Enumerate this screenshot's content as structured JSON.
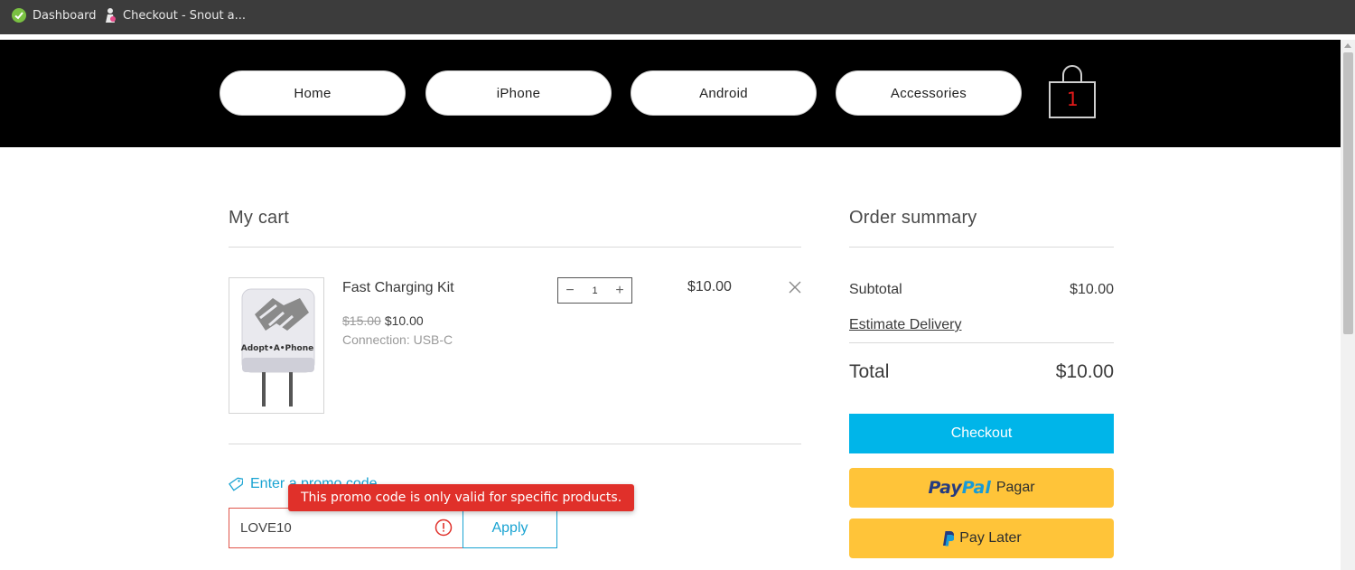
{
  "browser": {
    "bookmarks": [
      {
        "label": "Dashboard",
        "icon": "dashboard-favicon"
      },
      {
        "label": "Checkout - Snout a...",
        "icon": "snout-favicon"
      }
    ]
  },
  "header": {
    "nav": [
      {
        "label": "Home"
      },
      {
        "label": "iPhone"
      },
      {
        "label": "Android"
      },
      {
        "label": "Accessories"
      }
    ],
    "cart_count": "1",
    "cart_icon": "shopping-bag-icon"
  },
  "cart": {
    "title": "My cart",
    "item": {
      "name": "Fast Charging Kit",
      "original_price": "$15.00",
      "price": "$10.00",
      "option": "Connection: USB-C",
      "image_brand": "Adopt•A•Phone",
      "quantity": "1",
      "total": "$10.00"
    },
    "promo": {
      "link_label": "Enter a promo code",
      "input_value": "LOVE10",
      "apply_label": "Apply",
      "error_message": "This promo code is only valid for specific products."
    }
  },
  "summary": {
    "title": "Order summary",
    "subtotal_label": "Subtotal",
    "subtotal_value": "$10.00",
    "estimate_label": "Estimate Delivery",
    "total_label": "Total",
    "total_value": "$10.00",
    "checkout_label": "Checkout",
    "paypal_pay": "Pay",
    "paypal_pal": "Pal",
    "paypal_action": "Pagar",
    "paylater_label": "Pay Later"
  },
  "colors": {
    "accent": "#00b5e9",
    "paypal_yellow": "#ffc439",
    "error_red": "#e0302a",
    "cart_count_red": "#e21a1a"
  }
}
